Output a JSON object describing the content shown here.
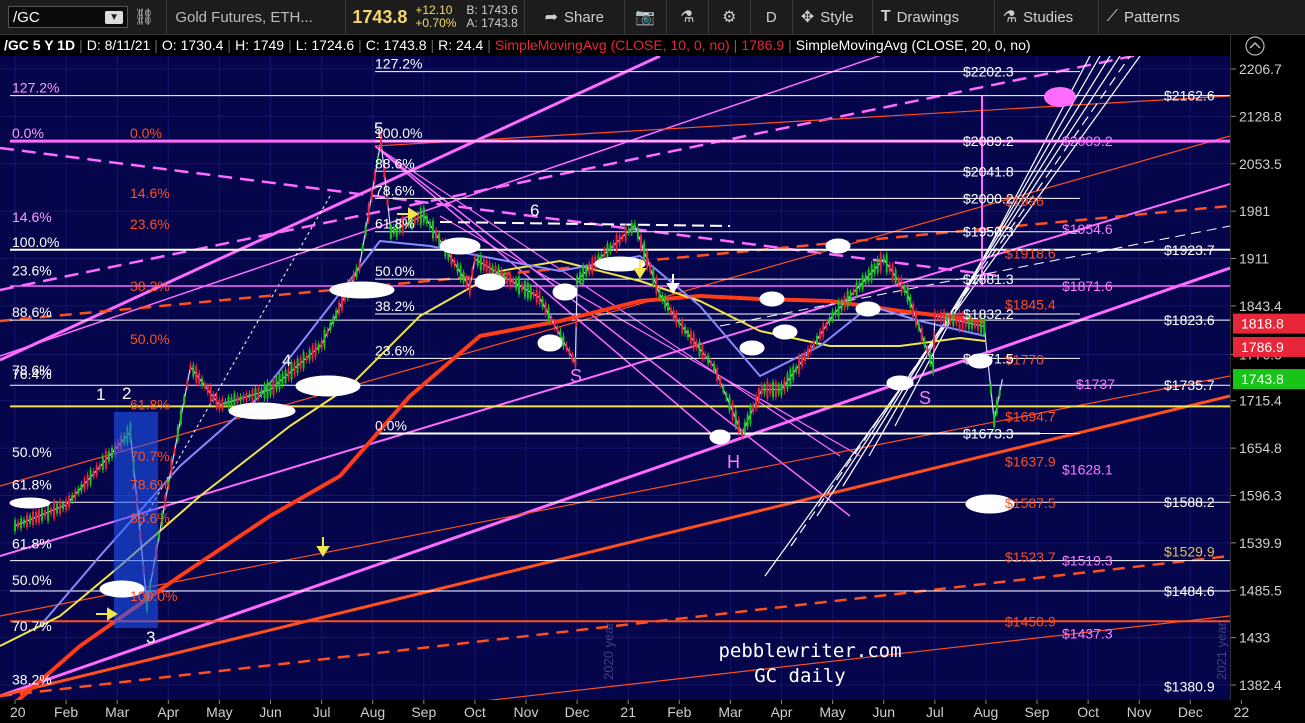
{
  "toolbar": {
    "symbol": "/GC",
    "description": "Gold Futures, ETH...",
    "last_price": "1743.8",
    "change_abs": "+12.10",
    "change_pct": "+0.70%",
    "bid": "B: 1743.6",
    "ask": "A: 1743.8",
    "share_label": "Share",
    "period": "D",
    "style_label": "Style",
    "drawings_label": "Drawings",
    "studies_label": "Studies",
    "patterns_label": "Patterns"
  },
  "infoline": {
    "symbol_period": "/GC 5 Y 1D",
    "date": "D: 8/11/21",
    "open": "O: 1730.4",
    "high": "H: 1749",
    "low": "L: 1724.6",
    "close": "C: 1743.8",
    "range": "R: 24.4",
    "sma10_label": "SimpleMovingAvg (CLOSE, 10, 0, no)",
    "sma10_value": "1786.9",
    "sma20_label": "SimpleMovingAvg (CLOSE, 20, 0, no)"
  },
  "watermark": {
    "site": "pebblewriter.com",
    "subtitle": "GC daily",
    "year_2020": "2020 year",
    "year_2021": "2021 year"
  },
  "colors": {
    "background": "#05054c",
    "sma10": "#e8263a",
    "sma20": "#ffffff",
    "sma50": "#f0e54a",
    "sma100": "#8a8aff",
    "sma200": "#ff3b1a",
    "channel_magenta": "#ff6bff",
    "fib_orange": "#ff4e20",
    "up_candle": "#19c419",
    "down_candle": "#e8263a"
  },
  "chart_data": {
    "type": "candlestick",
    "symbol": "/GC",
    "interval": "1D",
    "x_ticks": [
      "20",
      "Feb",
      "Mar",
      "Apr",
      "May",
      "Jun",
      "Jul",
      "Aug",
      "Sep",
      "Oct",
      "Nov",
      "Dec",
      "21",
      "Feb",
      "Mar",
      "Apr",
      "May",
      "Jun",
      "Jul",
      "Aug",
      "Sep",
      "Oct",
      "Nov",
      "Dec",
      "22"
    ],
    "y_ticks": [
      2206.7,
      2128.8,
      2053.5,
      1981,
      1911,
      1843.4,
      1776.6,
      1715.4,
      1654.8,
      1596.3,
      1539.9,
      1485.5,
      1433,
      1382.4
    ],
    "ylim": [
      1382.4,
      2206.7
    ],
    "price_badges": [
      {
        "label": "1818.8",
        "color": "#e8263a"
      },
      {
        "label": "1786.9",
        "color": "#e8263a"
      },
      {
        "label": "1743.8",
        "color": "#19c419"
      }
    ],
    "price_path": [
      {
        "x": "2020-01",
        "y": 1560
      },
      {
        "x": "2020-02",
        "y": 1585
      },
      {
        "x": "2020-03-09",
        "y": 1675
      },
      {
        "x": "2020-03-19",
        "y": 1470
      },
      {
        "x": "2020-04",
        "y": 1610
      },
      {
        "x": "2020-04-14",
        "y": 1760
      },
      {
        "x": "2020-05",
        "y": 1710
      },
      {
        "x": "2020-06",
        "y": 1730
      },
      {
        "x": "2020-07",
        "y": 1790
      },
      {
        "x": "2020-07-24",
        "y": 1900
      },
      {
        "x": "2020-08-06",
        "y": 2089.2
      },
      {
        "x": "2020-08-12",
        "y": 1950
      },
      {
        "x": "2020-09",
        "y": 1975
      },
      {
        "x": "2020-09-28",
        "y": 1870
      },
      {
        "x": "2020-10",
        "y": 1910
      },
      {
        "x": "2020-11-09",
        "y": 1855
      },
      {
        "x": "2020-11-30",
        "y": 1765
      },
      {
        "x": "2020-12",
        "y": 1880
      },
      {
        "x": "2021-01-05",
        "y": 1960
      },
      {
        "x": "2021-01-20",
        "y": 1860
      },
      {
        "x": "2021-02",
        "y": 1820
      },
      {
        "x": "2021-02-20",
        "y": 1760
      },
      {
        "x": "2021-03-08",
        "y": 1673.3
      },
      {
        "x": "2021-03-20",
        "y": 1730
      },
      {
        "x": "2021-04",
        "y": 1730
      },
      {
        "x": "2021-04-20",
        "y": 1790
      },
      {
        "x": "2021-05",
        "y": 1830
      },
      {
        "x": "2021-06-01",
        "y": 1910
      },
      {
        "x": "2021-06-15",
        "y": 1860
      },
      {
        "x": "2021-06-30",
        "y": 1760
      },
      {
        "x": "2021-07",
        "y": 1830
      },
      {
        "x": "2021-07-31",
        "y": 1815
      },
      {
        "x": "2021-08-06",
        "y": 1690
      },
      {
        "x": "2021-08-11",
        "y": 1743.8
      }
    ],
    "moving_averages": [
      {
        "name": "SimpleMovingAvg (CLOSE, 10, 0, no)",
        "value": 1786.9,
        "color": "#e8263a"
      },
      {
        "name": "SimpleMovingAvg (CLOSE, 20, 0, no)",
        "value": 1818.8,
        "color": "#ffffff"
      }
    ],
    "right_levels": [
      {
        "label": "$2162.6",
        "value": 2162.6
      },
      {
        "label": "$2089.2",
        "value": 2089.2
      },
      {
        "label": "$1954.6",
        "value": 1954.6
      },
      {
        "label": "$1923.7",
        "value": 1923.7
      },
      {
        "label": "$1871.6",
        "value": 1871.6
      },
      {
        "label": "$1823.6",
        "value": 1823.6
      },
      {
        "label": "$1737",
        "value": 1737
      },
      {
        "label": "$1735.7",
        "value": 1735.7
      },
      {
        "label": "$1628.1",
        "value": 1628.1
      },
      {
        "label": "$1588.2",
        "value": 1588.2
      },
      {
        "label": "$1529.9",
        "value": 1529.9
      },
      {
        "label": "$1519.3",
        "value": 1519.3
      },
      {
        "label": "$1484.6",
        "value": 1484.6
      },
      {
        "label": "$1437.3",
        "value": 1437.3
      },
      {
        "label": "$1380.9",
        "value": 1380.9
      }
    ],
    "fib_levels_orange": [
      {
        "label": "$1996",
        "value": 1996
      },
      {
        "label": "$1918.6",
        "value": 1918.6
      },
      {
        "label": "$1845.4",
        "value": 1845.4
      },
      {
        "label": "$1770",
        "value": 1770
      },
      {
        "label": "$1694.7",
        "value": 1694.7
      },
      {
        "label": "$1637.9",
        "value": 1637.9
      },
      {
        "label": "$1587.5",
        "value": 1587.5
      },
      {
        "label": "$1523.7",
        "value": 1523.7
      },
      {
        "label": "$1450.9",
        "value": 1450.9
      }
    ],
    "fib_levels_white": [
      {
        "label": "$2202.3",
        "value": 2202.3
      },
      {
        "label": "$2089.2",
        "value": 2089.2
      },
      {
        "label": "$2041.8",
        "value": 2041.8
      },
      {
        "label": "$2000.2",
        "value": 2000.2
      },
      {
        "label": "$1950.3",
        "value": 1950.3
      },
      {
        "label": "$1881.3",
        "value": 1881.3
      },
      {
        "label": "$1832.2",
        "value": 1832.2
      },
      {
        "label": "$1771.5",
        "value": 1771.5
      },
      {
        "label": "$1673.3",
        "value": 1673.3
      }
    ],
    "fib_pct_white": [
      "127.2%",
      "100.0%",
      "88.6%",
      "78.6%",
      "61.8%",
      "50.0%",
      "38.2%",
      "23.6%",
      "0.0%"
    ],
    "fib_pct_orange": [
      "0.0%",
      "14.6%",
      "23.6%",
      "38.2%",
      "50.0%",
      "61.8%",
      "70.7%",
      "78.6%",
      "88.6%",
      "100.0%"
    ],
    "fib_pct_magenta": [
      "127.2%",
      "0.0%",
      "14.6%",
      "100.0%",
      "23.6%",
      "88.6%",
      "78.6%",
      "76.4%",
      "61.8%",
      "50.0%",
      "61.8%",
      "50.0%",
      "70.7%",
      "38.2%"
    ],
    "wave_labels": [
      "1",
      "2",
      "3",
      "4",
      "5",
      "6"
    ],
    "pattern_labels": [
      "S",
      "H",
      "S"
    ]
  }
}
